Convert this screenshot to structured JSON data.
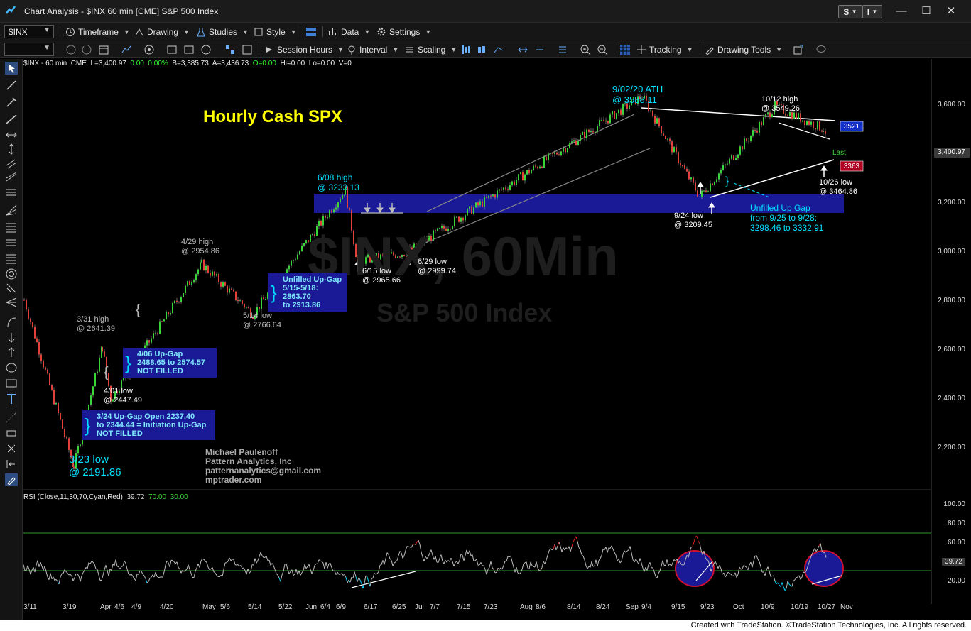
{
  "window": {
    "title": "Chart Analysis - $INX 60 min [CME] S&P 500 Index",
    "buttons": [
      "S",
      "I"
    ]
  },
  "toolbar1": {
    "symbol": "$INX",
    "timeframe": "Timeframe",
    "drawing": "Drawing",
    "studies": "Studies",
    "style": "Style",
    "data": "Data",
    "settings": "Settings"
  },
  "toolbar2": {
    "session_hours": "Session Hours",
    "interval": "Interval",
    "scaling": "Scaling",
    "tracking": "Tracking",
    "drawing_tools": "Drawing Tools"
  },
  "status_line": {
    "symbol": "$INX - 60 min",
    "exchange": "CME",
    "last": "L=3,400.97",
    "change": "0.00",
    "change_pct": "0.00%",
    "bid": "B=3,385.73",
    "ask": "A=3,436.73",
    "open": "O=0.00",
    "high": "Hi=0.00",
    "low": "Lo=0.00",
    "volume": "V=0"
  },
  "watermark": {
    "symbol": "$INX, 60Min",
    "name": "S&P 500 Index"
  },
  "headline": "Hourly Cash SPX",
  "annotations": {
    "ath": [
      "9/02/20 ATH",
      "@ 3588.11"
    ],
    "high_1012": [
      "10/12 high",
      "@ 3549.26"
    ],
    "high_608": [
      "6/08 high",
      "@ 3233.13"
    ],
    "high_429": [
      "4/29 high",
      "@ 2954.86"
    ],
    "high_331": [
      "3/31 high",
      "@ 2641.39"
    ],
    "low_401": [
      "4/01 low",
      "@ 2447.49"
    ],
    "low_323": [
      "3/23 low",
      "@ 2191.86"
    ],
    "low_514": [
      "5/14 low",
      "@ 2766.64"
    ],
    "low_615": [
      "6/15 low",
      "@ 2965.66"
    ],
    "low_629": [
      "6/29 low",
      "@ 2999.74"
    ],
    "low_924": [
      "9/24 low",
      "@ 3209.45"
    ],
    "low_1026": [
      "10/26 low",
      "@ 3464.86"
    ],
    "unfilled_gap": [
      "Unfilled Up Gap",
      "from 9/25 to 9/28:",
      "3298.46 to 3332.91"
    ],
    "gap_515": [
      "Unfilled Up-Gap",
      "5/15-5/18: 2863.70",
      "to 2913.86"
    ],
    "gap_406": [
      "4/06 Up-Gap",
      "2488.65 to 2574.57",
      "NOT FILLED"
    ],
    "gap_324": [
      "3/24 Up-Gap Open 2237.40",
      "to 2344.44 = Initiation Up-Gap",
      "NOT FILLED"
    ],
    "author": [
      "Michael Paulenoff",
      "Pattern Analytics, Inc",
      "patternanalytics@gmail.com",
      "mptrader.com"
    ],
    "last_label": "Last"
  },
  "price_axis": {
    "ticks": [
      "3,600.00",
      "3,400.00",
      "3,200.00",
      "3,000.00",
      "2,800.00",
      "2,600.00",
      "2,400.00",
      "2,200.00"
    ],
    "last_value": "3,400.97",
    "marker_high": "3521",
    "marker_low": "3363",
    "colors": {
      "last": "#3a3a3a",
      "marker_high": "#1030c8",
      "marker_low": "#b00020"
    }
  },
  "rsi": {
    "label": "RSI (Close,11,30,70,Cyan,Red)",
    "value": "39.72",
    "overbought": "70.00",
    "oversold": "30.00",
    "ticks": [
      "100.00",
      "80.00",
      "60.00",
      "40.00",
      "20.00"
    ]
  },
  "time_axis": [
    "3/11",
    "3/19",
    "Apr",
    "4/6",
    "4/9",
    "4/20",
    "May",
    "5/6",
    "5/14",
    "5/22",
    "Jun",
    "6/4",
    "6/9",
    "6/17",
    "6/25",
    "Jul",
    "7/7",
    "7/15",
    "7/23",
    "Aug",
    "8/6",
    "8/14",
    "8/24",
    "Sep",
    "9/4",
    "9/15",
    "9/23",
    "Oct",
    "10/9",
    "10/19",
    "10/27",
    "Nov"
  ],
  "footer": "Created with TradeStation. ©TradeStation Technologies, Inc. All rights reserved.",
  "chart_data": {
    "type": "line",
    "series": [
      {
        "x": [
          "3/11",
          "3/23",
          "3/31",
          "4/01",
          "4/29",
          "5/14",
          "6/08",
          "6/15",
          "6/29",
          "9/02",
          "9/24",
          "10/12",
          "10/26",
          "10/27"
        ],
        "values": [
          2820,
          2191.86,
          2641.39,
          2447.49,
          2954.86,
          2766.64,
          3233.13,
          2965.66,
          2999.74,
          3588.11,
          3209.45,
          3549.26,
          3464.86,
          3400.97
        ]
      }
    ],
    "ylim": [
      2150,
      3680
    ],
    "rsi_levels": [
      30,
      70
    ]
  }
}
